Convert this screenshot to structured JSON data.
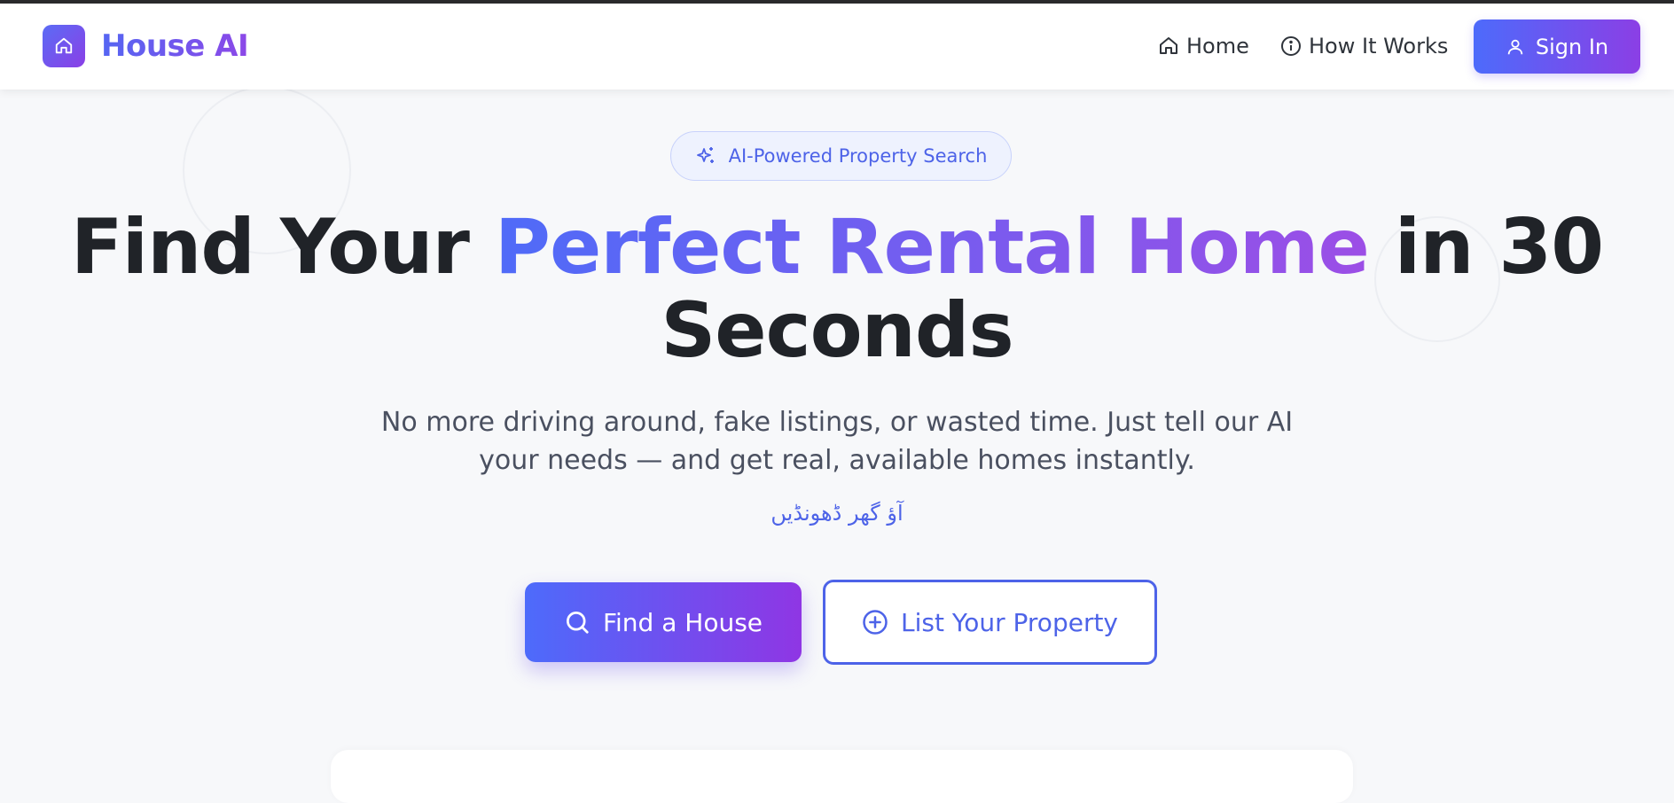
{
  "navbar": {
    "brand": "House AI",
    "links": [
      {
        "label": "Home",
        "icon": "home-icon"
      },
      {
        "label": "How It Works",
        "icon": "info-icon"
      }
    ],
    "signin_label": "Sign In",
    "signin_icon": "user-icon"
  },
  "hero": {
    "badge": "AI-Powered Property Search",
    "title_part1": "Find Your ",
    "title_highlight": "Perfect Rental Home",
    "title_part2": " in 30 Seconds",
    "subtitle": "No more driving around, fake listings, or wasted time. Just tell our AI your needs — and get real, available homes instantly.",
    "urdu_tagline": "آؤ گھر ڈھونڈیں",
    "find_button": "Find a House",
    "list_button": "List Your Property"
  },
  "colors": {
    "accent": "#4d63e8",
    "gradient_start": "#4d6bfb",
    "gradient_end": "#8f36e4",
    "heading": "#202328",
    "background": "#f7f8fa"
  }
}
